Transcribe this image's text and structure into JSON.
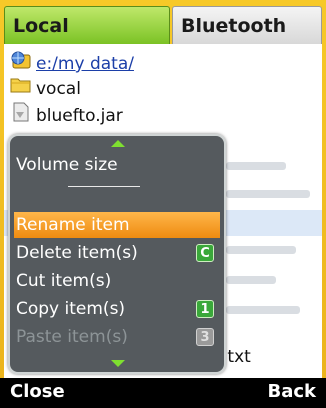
{
  "tabs": [
    {
      "label": "Local",
      "active": true
    },
    {
      "label": "Bluetooth",
      "active": false
    }
  ],
  "files": {
    "path": "e:/my data/",
    "items": [
      {
        "name": "vocal",
        "icon": "folder-icon"
      },
      {
        "name": "bluefto.jar",
        "icon": "jar-file-icon"
      }
    ],
    "partial_item": ".txt"
  },
  "menu": {
    "volume_label": "Volume size",
    "items": [
      {
        "label": "Rename item",
        "shortcut": "",
        "state": "highlighted"
      },
      {
        "label": "Delete item(s)",
        "shortcut": "C",
        "state": "enabled"
      },
      {
        "label": "Cut item(s)",
        "shortcut": "",
        "state": "enabled"
      },
      {
        "label": "Copy item(s)",
        "shortcut": "1",
        "state": "enabled"
      },
      {
        "label": "Paste item(s)",
        "shortcut": "3",
        "state": "disabled"
      }
    ]
  },
  "softkeys": {
    "left": "Close",
    "right": "Back"
  },
  "colors": {
    "highlight": "#ee8b10",
    "accent_green": "#7bc225",
    "menu_bg": "#484e52"
  }
}
